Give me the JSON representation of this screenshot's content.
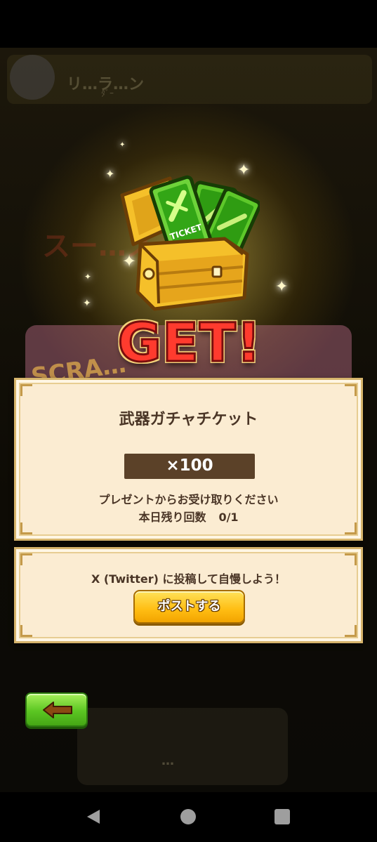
{
  "background": {
    "header_text": "リ…ラ…ン",
    "header_sub": "ﾀﾞｰ",
    "banner_text": "スー…ス",
    "card_text": "SCRA…",
    "bottom_text": "…"
  },
  "reward": {
    "get_label": "GET!",
    "chest_ticket_label": "TICKET",
    "item_name": "武器ガチャチケット",
    "quantity": "×100",
    "message": "プレゼントからお受け取りください",
    "remaining_label": "本日残り回数",
    "remaining_value": "0/1"
  },
  "share": {
    "prompt": "X (Twitter) に投稿して自慢しよう！",
    "post_button": "ポストする"
  },
  "colors": {
    "panel_bg": "#fbecd2",
    "panel_border": "#d6b46b",
    "quantity_bar": "#5b4128",
    "post_button": "#ffbd12",
    "back_button": "#5bc622",
    "get_text": "#ff3b2e"
  },
  "icons": {
    "back_button": "left-arrow-icon",
    "nav_back": "triangle-back-icon",
    "nav_home": "circle-home-icon",
    "nav_recent": "square-recents-icon"
  }
}
